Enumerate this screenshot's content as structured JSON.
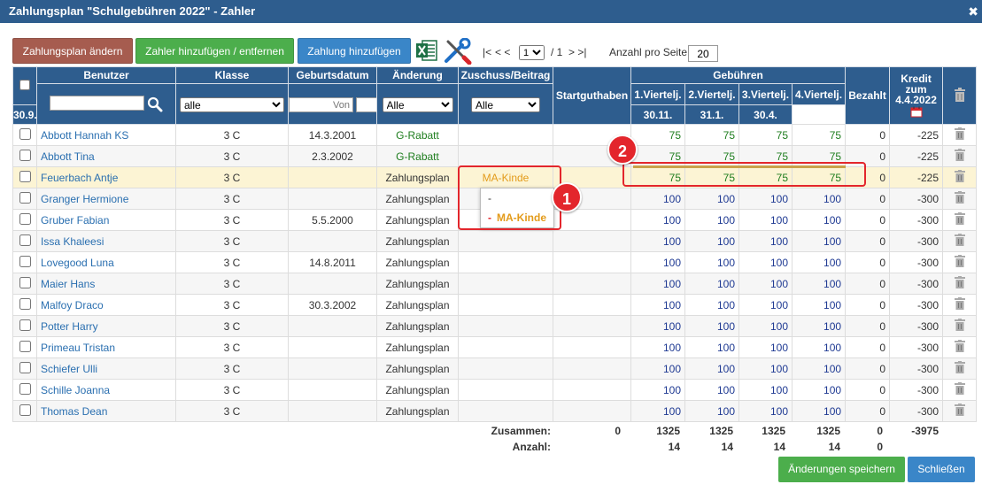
{
  "window": {
    "title": "Zahlungsplan \"Schulgebühren 2022\" - Zahler",
    "close": "✖"
  },
  "toolbar": {
    "edit_plan": "Zahlungsplan ändern",
    "add_remove_payer": "Zahler hinzufügen / entfernen",
    "add_payment": "Zahlung hinzufügen",
    "pager_first": "|<",
    "pager_prev": "< <",
    "page_value": "1",
    "page_total": "/ 1",
    "pager_next": "> >|",
    "per_page_label": "Anzahl pro Seite:",
    "per_page_value": "20"
  },
  "headers": {
    "user": "Benutzer",
    "class": "Klasse",
    "birthdate": "Geburtsdatum",
    "change": "Änderung",
    "subsidy": "Zuschuss/Beitrag",
    "start_credit": "Startguthaben",
    "fees": "Gebühren",
    "q1": "1.Viertelj.",
    "q1_date": "30.9.",
    "q2": "2.Viertelj.",
    "q2_date": "30.11.",
    "q3": "3.Viertelj.",
    "q3_date": "31.1.",
    "q4": "4.Viertelj.",
    "q4_date": "30.4.",
    "paid": "Bezahlt",
    "credit_l1": "Kredit",
    "credit_l2": "zum",
    "credit_l3": "4.4.2022"
  },
  "filters": {
    "class_value": "alle",
    "from_placeholder": "Von",
    "to_placeholder": "Bis",
    "change_value": "Alle",
    "subsidy_value": "Alle"
  },
  "rows": [
    {
      "name": "Abbott Hannah KS",
      "class": "3 C",
      "birth": "14.3.2001",
      "change": "G-Rabatt",
      "subsidy": "",
      "q1": "75",
      "q2": "75",
      "q3": "75",
      "q4": "75",
      "paid": "0",
      "credit": "-225"
    },
    {
      "name": "Abbott Tina",
      "class": "3 C",
      "birth": "2.3.2002",
      "change": "G-Rabatt",
      "subsidy": "",
      "q1": "75",
      "q2": "75",
      "q3": "75",
      "q4": "75",
      "paid": "0",
      "credit": "-225"
    },
    {
      "name": "Feuerbach Antje",
      "class": "3 C",
      "birth": "",
      "change": "Zahlungsplan",
      "subsidy": "MA-Kinde",
      "q1": "75",
      "q2": "75",
      "q3": "75",
      "q4": "75",
      "paid": "0",
      "credit": "-225"
    },
    {
      "name": "Granger Hermione",
      "class": "3 C",
      "birth": "",
      "change": "Zahlungsplan",
      "subsidy": "",
      "q1": "100",
      "q2": "100",
      "q3": "100",
      "q4": "100",
      "paid": "0",
      "credit": "-300"
    },
    {
      "name": "Gruber Fabian",
      "class": "3 C",
      "birth": "5.5.2000",
      "change": "Zahlungsplan",
      "subsidy": "",
      "q1": "100",
      "q2": "100",
      "q3": "100",
      "q4": "100",
      "paid": "0",
      "credit": "-300"
    },
    {
      "name": "Issa Khaleesi",
      "class": "3 C",
      "birth": "",
      "change": "Zahlungsplan",
      "subsidy": "",
      "q1": "100",
      "q2": "100",
      "q3": "100",
      "q4": "100",
      "paid": "0",
      "credit": "-300"
    },
    {
      "name": "Lovegood Luna",
      "class": "3 C",
      "birth": "14.8.2011",
      "change": "Zahlungsplan",
      "subsidy": "",
      "q1": "100",
      "q2": "100",
      "q3": "100",
      "q4": "100",
      "paid": "0",
      "credit": "-300"
    },
    {
      "name": "Maier Hans",
      "class": "3 C",
      "birth": "",
      "change": "Zahlungsplan",
      "subsidy": "",
      "q1": "100",
      "q2": "100",
      "q3": "100",
      "q4": "100",
      "paid": "0",
      "credit": "-300"
    },
    {
      "name": "Malfoy Draco",
      "class": "3 C",
      "birth": "30.3.2002",
      "change": "Zahlungsplan",
      "subsidy": "",
      "q1": "100",
      "q2": "100",
      "q3": "100",
      "q4": "100",
      "paid": "0",
      "credit": "-300"
    },
    {
      "name": "Potter Harry",
      "class": "3 C",
      "birth": "",
      "change": "Zahlungsplan",
      "subsidy": "",
      "q1": "100",
      "q2": "100",
      "q3": "100",
      "q4": "100",
      "paid": "0",
      "credit": "-300"
    },
    {
      "name": "Primeau Tristan",
      "class": "3 C",
      "birth": "",
      "change": "Zahlungsplan",
      "subsidy": "",
      "q1": "100",
      "q2": "100",
      "q3": "100",
      "q4": "100",
      "paid": "0",
      "credit": "-300"
    },
    {
      "name": "Schiefer Ulli",
      "class": "3 C",
      "birth": "",
      "change": "Zahlungsplan",
      "subsidy": "",
      "q1": "100",
      "q2": "100",
      "q3": "100",
      "q4": "100",
      "paid": "0",
      "credit": "-300"
    },
    {
      "name": "Schille Joanna",
      "class": "3 C",
      "birth": "",
      "change": "Zahlungsplan",
      "subsidy": "",
      "q1": "100",
      "q2": "100",
      "q3": "100",
      "q4": "100",
      "paid": "0",
      "credit": "-300"
    },
    {
      "name": "Thomas Dean",
      "class": "3 C",
      "birth": "",
      "change": "Zahlungsplan",
      "subsidy": "",
      "q1": "100",
      "q2": "100",
      "q3": "100",
      "q4": "100",
      "paid": "0",
      "credit": "-300"
    }
  ],
  "dropdown": {
    "opt1": "-",
    "opt2_dash": "-",
    "opt2_label": "MA-Kinde"
  },
  "annotations": {
    "badge1": "1",
    "badge2": "2"
  },
  "totals": {
    "sum_label": "Zusammen:",
    "sum_start": "0",
    "sum_q1": "1325",
    "sum_q2": "1325",
    "sum_q3": "1325",
    "sum_q4": "1325",
    "sum_paid": "0",
    "sum_credit": "-3975",
    "count_label": "Anzahl:",
    "count_q1": "14",
    "count_q2": "14",
    "count_q3": "14",
    "count_q4": "14",
    "count_paid": "0"
  },
  "footer": {
    "save": "Änderungen speichern",
    "close": "Schließen"
  },
  "colors": {
    "header_blue": "#2e5d8e",
    "green": "#4cae4c",
    "blue_btn": "#3a86c8",
    "brown_btn": "#a65c4f",
    "highlight_red": "#e3262c",
    "selected_row": "#fcf4d4"
  }
}
